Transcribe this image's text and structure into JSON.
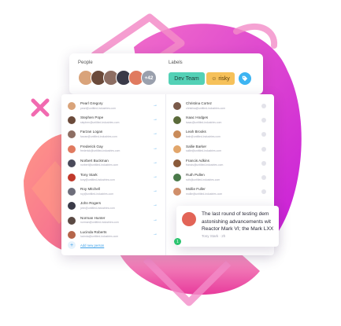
{
  "people_panel": {
    "title": "People",
    "more_count": "+42"
  },
  "labels_panel": {
    "title": "Labels",
    "tags": [
      "Dev Team",
      "risky"
    ],
    "tag_icon": "tag-icon"
  },
  "left_list": [
    {
      "name": "Pearl Gregory",
      "email": "pearl@untitled-industries.com",
      "color": "#d9a37a"
    },
    {
      "name": "Stephen Pope",
      "email": "stephen@untitled-industries.com",
      "color": "#6b4a3a"
    },
    {
      "name": "Farzan Logan",
      "email": "farzan@untitled-industries.com",
      "color": "#8d6e63"
    },
    {
      "name": "Frederick Gay",
      "email": "frederick@untitled-industries.com",
      "color": "#e07a5f"
    },
    {
      "name": "Norbert Buckman",
      "email": "norbert@untitled-industries.com",
      "color": "#4a4a5a"
    },
    {
      "name": "Tony Stark",
      "email": "tony@untitled-industries.com",
      "color": "#c0392b"
    },
    {
      "name": "Roy Mitchell",
      "email": "roy@untitled-industries.com",
      "color": "#6d6d7a"
    },
    {
      "name": "John Rogers",
      "email": "john@untitled-industries.com",
      "color": "#3a3a48"
    },
    {
      "name": "Norman Hunter",
      "email": "norman@untitled-industries.com",
      "color": "#5b4a44"
    },
    {
      "name": "Lucinda Roberts",
      "email": "lucinda@untitled-industries.com",
      "color": "#b5654a"
    }
  ],
  "add_person_label": "Add new person",
  "right_list": [
    {
      "name": "Christina Cortez",
      "email": "christina@untitled-industries.com",
      "color": "#7a5a4a"
    },
    {
      "name": "Isaac Hodges",
      "email": "isaac@untitled-industries.com",
      "color": "#5a6a3a"
    },
    {
      "name": "Leah Brooks",
      "email": "leah@untitled-industries.com",
      "color": "#c98b5a"
    },
    {
      "name": "Sallie Barker",
      "email": "sallie@untitled-industries.com",
      "color": "#e2a66b"
    },
    {
      "name": "Francis Adkins",
      "email": "francis@untitled-industries.com",
      "color": "#8a5a3a"
    },
    {
      "name": "Ruth Pullen",
      "email": "ruth@untitled-industries.com",
      "color": "#4a7a4a"
    },
    {
      "name": "Mollie Fuller",
      "email": "mollie@untitled-industries.com",
      "color": "#d08f6a"
    }
  ],
  "message": {
    "lines": [
      "The last round of testing dem",
      "astonishing advancements wit",
      "Reactor Mark VI; the Mark LXX"
    ],
    "meta": "Tony Stark · 2h",
    "badge": "1"
  },
  "colors": {
    "accent_blue": "#3da0e8",
    "dev_team": "#53d1b6",
    "risky": "#f6c15a",
    "brand_pink": "#ea3ad0"
  }
}
